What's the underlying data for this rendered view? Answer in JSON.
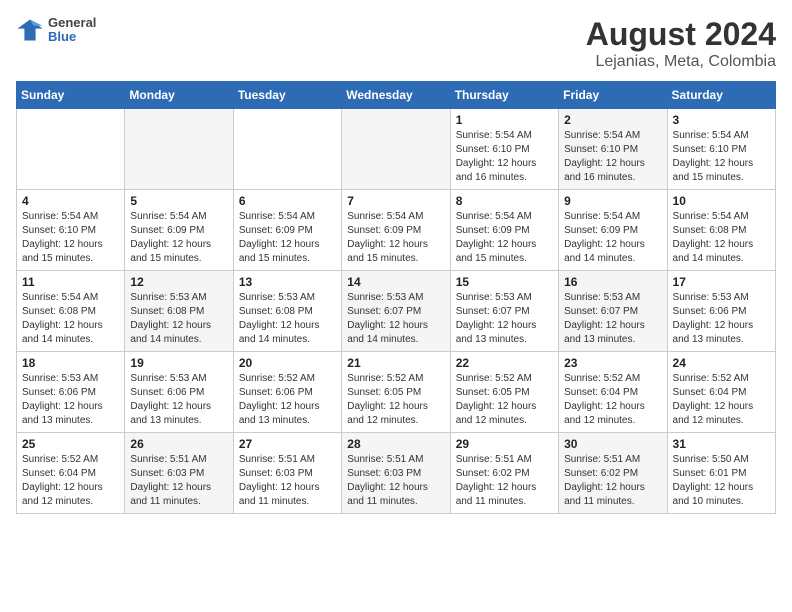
{
  "header": {
    "logo_general": "General",
    "logo_blue": "Blue",
    "title": "August 2024",
    "subtitle": "Lejanias, Meta, Colombia"
  },
  "days_of_week": [
    "Sunday",
    "Monday",
    "Tuesday",
    "Wednesday",
    "Thursday",
    "Friday",
    "Saturday"
  ],
  "weeks": [
    [
      {
        "day": "",
        "info": ""
      },
      {
        "day": "",
        "info": ""
      },
      {
        "day": "",
        "info": ""
      },
      {
        "day": "",
        "info": ""
      },
      {
        "day": "1",
        "info": "Sunrise: 5:54 AM\nSunset: 6:10 PM\nDaylight: 12 hours\nand 16 minutes."
      },
      {
        "day": "2",
        "info": "Sunrise: 5:54 AM\nSunset: 6:10 PM\nDaylight: 12 hours\nand 16 minutes."
      },
      {
        "day": "3",
        "info": "Sunrise: 5:54 AM\nSunset: 6:10 PM\nDaylight: 12 hours\nand 15 minutes."
      }
    ],
    [
      {
        "day": "4",
        "info": "Sunrise: 5:54 AM\nSunset: 6:10 PM\nDaylight: 12 hours\nand 15 minutes."
      },
      {
        "day": "5",
        "info": "Sunrise: 5:54 AM\nSunset: 6:09 PM\nDaylight: 12 hours\nand 15 minutes."
      },
      {
        "day": "6",
        "info": "Sunrise: 5:54 AM\nSunset: 6:09 PM\nDaylight: 12 hours\nand 15 minutes."
      },
      {
        "day": "7",
        "info": "Sunrise: 5:54 AM\nSunset: 6:09 PM\nDaylight: 12 hours\nand 15 minutes."
      },
      {
        "day": "8",
        "info": "Sunrise: 5:54 AM\nSunset: 6:09 PM\nDaylight: 12 hours\nand 15 minutes."
      },
      {
        "day": "9",
        "info": "Sunrise: 5:54 AM\nSunset: 6:09 PM\nDaylight: 12 hours\nand 14 minutes."
      },
      {
        "day": "10",
        "info": "Sunrise: 5:54 AM\nSunset: 6:08 PM\nDaylight: 12 hours\nand 14 minutes."
      }
    ],
    [
      {
        "day": "11",
        "info": "Sunrise: 5:54 AM\nSunset: 6:08 PM\nDaylight: 12 hours\nand 14 minutes."
      },
      {
        "day": "12",
        "info": "Sunrise: 5:53 AM\nSunset: 6:08 PM\nDaylight: 12 hours\nand 14 minutes."
      },
      {
        "day": "13",
        "info": "Sunrise: 5:53 AM\nSunset: 6:08 PM\nDaylight: 12 hours\nand 14 minutes."
      },
      {
        "day": "14",
        "info": "Sunrise: 5:53 AM\nSunset: 6:07 PM\nDaylight: 12 hours\nand 14 minutes."
      },
      {
        "day": "15",
        "info": "Sunrise: 5:53 AM\nSunset: 6:07 PM\nDaylight: 12 hours\nand 13 minutes."
      },
      {
        "day": "16",
        "info": "Sunrise: 5:53 AM\nSunset: 6:07 PM\nDaylight: 12 hours\nand 13 minutes."
      },
      {
        "day": "17",
        "info": "Sunrise: 5:53 AM\nSunset: 6:06 PM\nDaylight: 12 hours\nand 13 minutes."
      }
    ],
    [
      {
        "day": "18",
        "info": "Sunrise: 5:53 AM\nSunset: 6:06 PM\nDaylight: 12 hours\nand 13 minutes."
      },
      {
        "day": "19",
        "info": "Sunrise: 5:53 AM\nSunset: 6:06 PM\nDaylight: 12 hours\nand 13 minutes."
      },
      {
        "day": "20",
        "info": "Sunrise: 5:52 AM\nSunset: 6:06 PM\nDaylight: 12 hours\nand 13 minutes."
      },
      {
        "day": "21",
        "info": "Sunrise: 5:52 AM\nSunset: 6:05 PM\nDaylight: 12 hours\nand 12 minutes."
      },
      {
        "day": "22",
        "info": "Sunrise: 5:52 AM\nSunset: 6:05 PM\nDaylight: 12 hours\nand 12 minutes."
      },
      {
        "day": "23",
        "info": "Sunrise: 5:52 AM\nSunset: 6:04 PM\nDaylight: 12 hours\nand 12 minutes."
      },
      {
        "day": "24",
        "info": "Sunrise: 5:52 AM\nSunset: 6:04 PM\nDaylight: 12 hours\nand 12 minutes."
      }
    ],
    [
      {
        "day": "25",
        "info": "Sunrise: 5:52 AM\nSunset: 6:04 PM\nDaylight: 12 hours\nand 12 minutes."
      },
      {
        "day": "26",
        "info": "Sunrise: 5:51 AM\nSunset: 6:03 PM\nDaylight: 12 hours\nand 11 minutes."
      },
      {
        "day": "27",
        "info": "Sunrise: 5:51 AM\nSunset: 6:03 PM\nDaylight: 12 hours\nand 11 minutes."
      },
      {
        "day": "28",
        "info": "Sunrise: 5:51 AM\nSunset: 6:03 PM\nDaylight: 12 hours\nand 11 minutes."
      },
      {
        "day": "29",
        "info": "Sunrise: 5:51 AM\nSunset: 6:02 PM\nDaylight: 12 hours\nand 11 minutes."
      },
      {
        "day": "30",
        "info": "Sunrise: 5:51 AM\nSunset: 6:02 PM\nDaylight: 12 hours\nand 11 minutes."
      },
      {
        "day": "31",
        "info": "Sunrise: 5:50 AM\nSunset: 6:01 PM\nDaylight: 12 hours\nand 10 minutes."
      }
    ]
  ]
}
